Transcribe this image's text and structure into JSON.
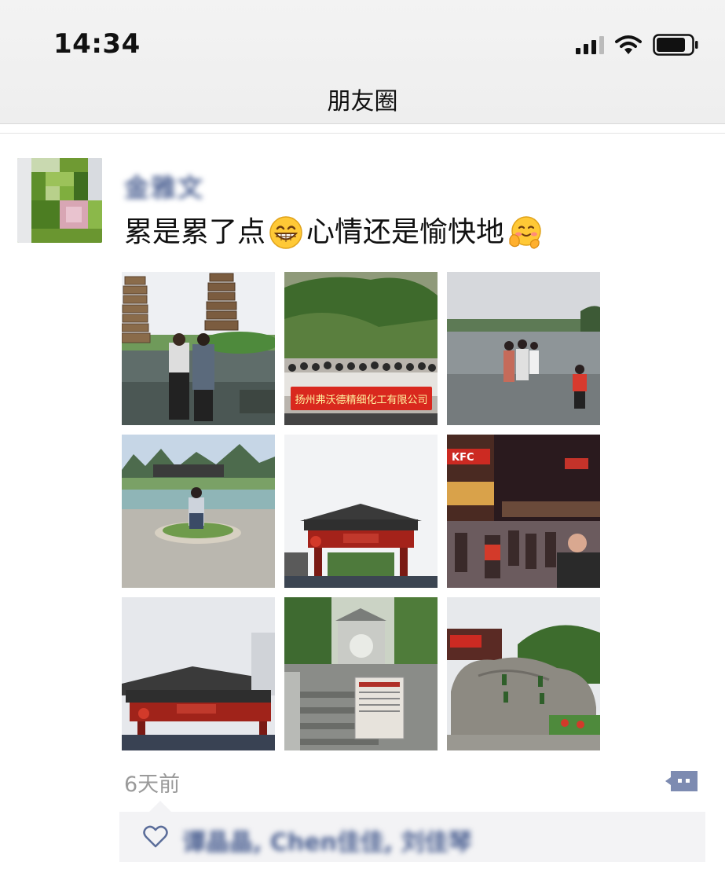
{
  "status_bar": {
    "time": "14:34"
  },
  "nav": {
    "title": "朋友圈"
  },
  "post": {
    "author": "金雅文",
    "text_part1": "累是累了点",
    "text_part2": "心情还是愉快地",
    "emojis": [
      "grinning-face-icon",
      "hugging-face-icon"
    ],
    "time_ago": "6天前",
    "likes": "谭晶晶, Chen佳佳, 刘佳琴",
    "photos": [
      {
        "name": "photo-twin-pagodas"
      },
      {
        "name": "photo-group-banner",
        "banner_text": "扬州弗沃德精细化工有限公司"
      },
      {
        "name": "photo-river-wading"
      },
      {
        "name": "photo-karst-plaza"
      },
      {
        "name": "photo-red-gate"
      },
      {
        "name": "photo-night-street",
        "sign_text": "KFC"
      },
      {
        "name": "photo-red-gate-2"
      },
      {
        "name": "photo-stone-pavilion"
      },
      {
        "name": "photo-carved-rock"
      }
    ]
  },
  "colors": {
    "name_blue": "#4a5f91",
    "like_bg": "#f3f3f5",
    "muted": "#9a9a9a"
  }
}
